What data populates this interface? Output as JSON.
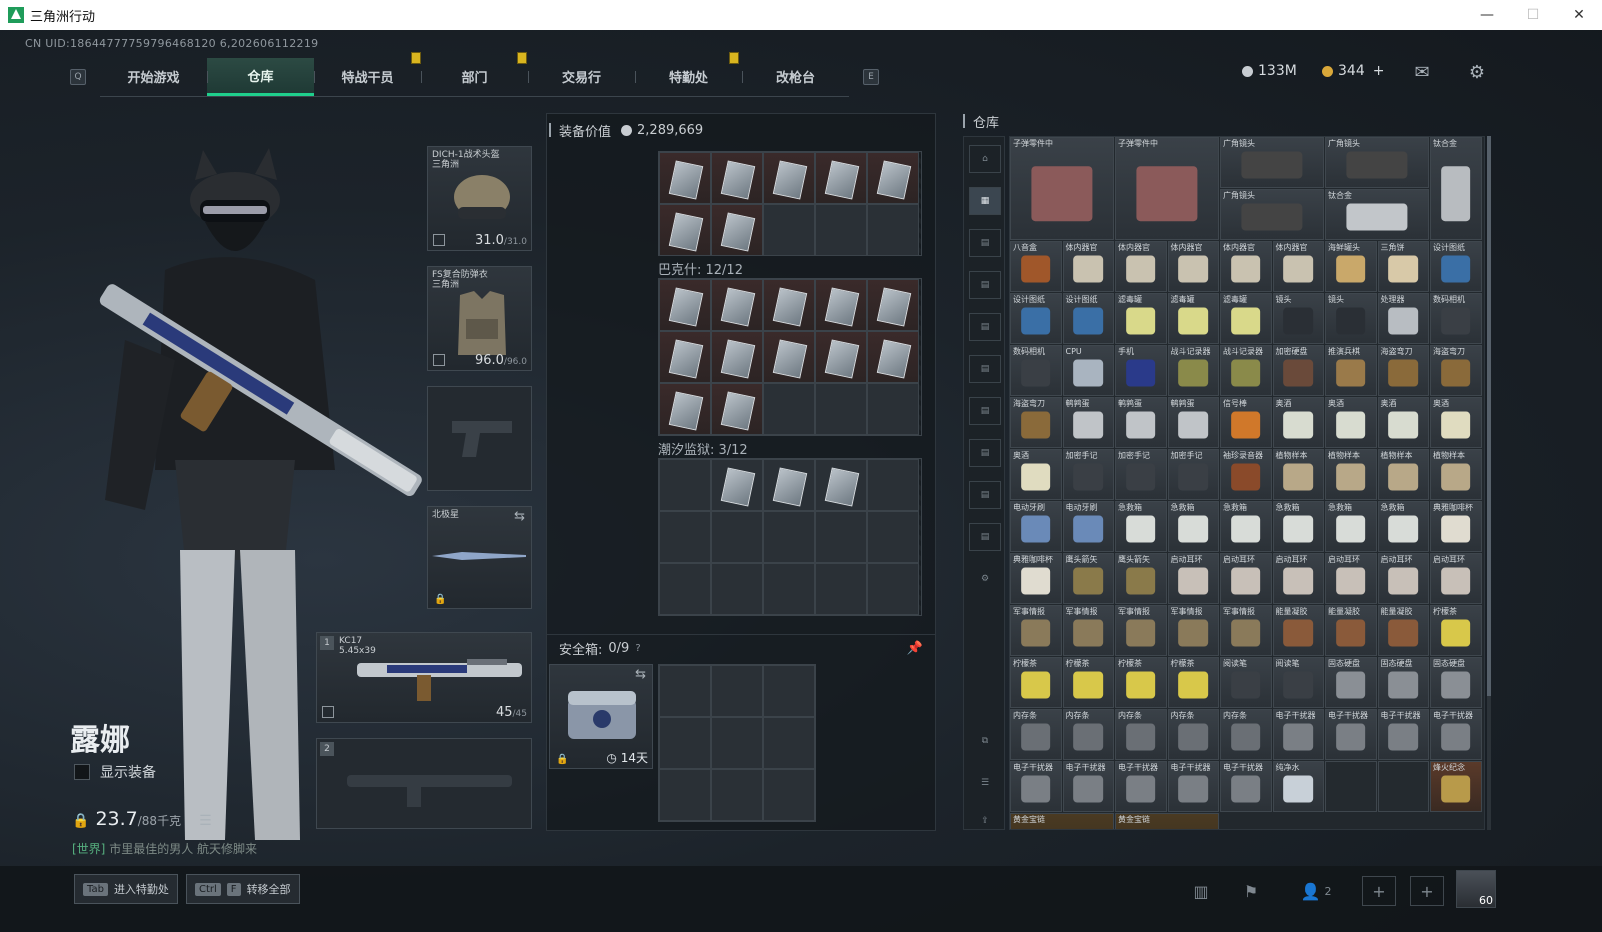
{
  "window": {
    "title": "三角洲行动",
    "min": "—",
    "max": "☐",
    "close": "✕"
  },
  "uid": "CN UID:18644777759796468120 6,202606112219",
  "nav": {
    "left_key": "Q",
    "right_key": "E",
    "tabs": [
      {
        "label": "开始游戏"
      },
      {
        "label": "仓库"
      },
      {
        "label": "特战干员"
      },
      {
        "label": "部门"
      },
      {
        "label": "交易行"
      },
      {
        "label": "特勤处"
      },
      {
        "label": "改枪台"
      }
    ]
  },
  "currency": {
    "silver": "133M",
    "gold": "344",
    "plus": "+"
  },
  "icons": {
    "mail": "mail-icon",
    "settings": "gear-icon"
  },
  "character": {
    "name": "露娜",
    "show_equipment": "显示装备",
    "weight": "23.7",
    "weight_max": "/88千克",
    "chat_channel": "[世界]",
    "chat_text": "市里最佳的男人 航天修脚来"
  },
  "equipment": {
    "helmet": {
      "name": "DICH-1战术头盔",
      "sub": "三角洲",
      "durability": "31.0",
      "max": "/31.0"
    },
    "armor": {
      "name": "FS复合防弹衣",
      "sub": "三角洲",
      "durability": "96.0",
      "max": "/96.0"
    },
    "melee": {
      "name": "北极星"
    },
    "primary": {
      "slot": "1",
      "name": "KC17",
      "ammo_label": "5.45x39",
      "ammo": "45",
      "ammo_max": "/45"
    },
    "secondary": {
      "slot": "2"
    }
  },
  "mid": {
    "value_label": "装备价值",
    "value": "2,289,669",
    "bags": [
      {
        "label": "巴克什: 12/12"
      },
      {
        "label": "潮汐监狱: 3/12"
      }
    ],
    "safe_label": "安全箱:",
    "safe_count": "0/9",
    "safe_help": "?",
    "safe_days": "14天"
  },
  "warehouse": {
    "title": "仓库",
    "items": [
      {
        "name": "子弹零件中",
        "color": "#8b5a5a"
      },
      {
        "name": "子弹零件中",
        "color": "#8b5a5a"
      },
      {
        "name": "广角镜头",
        "color": "#444"
      },
      {
        "name": "广角镜头",
        "color": "#444"
      },
      {
        "name": "钛合金",
        "color": "#b8bcc0"
      },
      {
        "name": "广角镜头",
        "color": "#444"
      },
      {
        "name": "钛合金",
        "color": "#c2c6ca"
      },
      {
        "name": "八音盒",
        "color": "#a0572a"
      },
      {
        "name": "体内器官",
        "color": "#c9c2b0"
      },
      {
        "name": "体内器官",
        "color": "#c9c2b0"
      },
      {
        "name": "体内器官",
        "color": "#c9c2b0"
      },
      {
        "name": "体内器官",
        "color": "#c9c2b0"
      },
      {
        "name": "体内器官",
        "color": "#c9c2b0"
      },
      {
        "name": "海鲜罐头",
        "color": "#c9a86a"
      },
      {
        "name": "三角饼",
        "color": "#d8c9a8"
      },
      {
        "name": "设计图纸",
        "color": "#3a6fa6"
      },
      {
        "name": "设计图纸",
        "color": "#3a6fa6"
      },
      {
        "name": "设计图纸",
        "color": "#3a6fa6"
      },
      {
        "name": "滤毒罐",
        "color": "#d9d98a"
      },
      {
        "name": "滤毒罐",
        "color": "#d9d98a"
      },
      {
        "name": "滤毒罐",
        "color": "#d9d98a"
      },
      {
        "name": "镜头",
        "color": "#2a2f35"
      },
      {
        "name": "镜头",
        "color": "#2a2f35"
      },
      {
        "name": "处理器",
        "color": "#b8bdc2"
      },
      {
        "name": "数码相机",
        "color": "#3a3f45"
      },
      {
        "name": "数码相机",
        "color": "#3a3f45"
      },
      {
        "name": "CPU",
        "color": "#a9b4c0"
      },
      {
        "name": "手机",
        "color": "#2a3a8a"
      },
      {
        "name": "战斗记录器",
        "color": "#8a8a4a"
      },
      {
        "name": "战斗记录器",
        "color": "#8a8a4a"
      },
      {
        "name": "加密硬盘",
        "color": "#6a4a3a"
      },
      {
        "name": "推演兵棋",
        "color": "#9a7a4a"
      },
      {
        "name": "海盗弯刀",
        "color": "#8a6a3a"
      },
      {
        "name": "海盗弯刀",
        "color": "#8a6a3a"
      },
      {
        "name": "海盗弯刀",
        "color": "#8a6a3a"
      },
      {
        "name": "鹌鹑蛋",
        "color": "#c0c4c8"
      },
      {
        "name": "鹌鹑蛋",
        "color": "#c0c4c8"
      },
      {
        "name": "鹌鹑蛋",
        "color": "#c0c4c8"
      },
      {
        "name": "信号棒",
        "color": "#d0782a"
      },
      {
        "name": "奥酒",
        "color": "#d8dcd0"
      },
      {
        "name": "奥酒",
        "color": "#d8dcd0"
      },
      {
        "name": "奥酒",
        "color": "#d8dcd0"
      },
      {
        "name": "奥酒",
        "color": "#e0dcc0"
      },
      {
        "name": "奥酒",
        "color": "#e0dcc0"
      },
      {
        "name": "加密手记",
        "color": "#3a3f45"
      },
      {
        "name": "加密手记",
        "color": "#3a3f45"
      },
      {
        "name": "加密手记",
        "color": "#3a3f45"
      },
      {
        "name": "袖珍录音器",
        "color": "#8a4a2a"
      },
      {
        "name": "植物样本",
        "color": "#b8a888"
      },
      {
        "name": "植物样本",
        "color": "#b8a888"
      },
      {
        "name": "植物样本",
        "color": "#b8a888"
      },
      {
        "name": "植物样本",
        "color": "#b8a888"
      },
      {
        "name": "电动牙刷",
        "color": "#6a8ab8"
      },
      {
        "name": "电动牙刷",
        "color": "#6a8ab8"
      },
      {
        "name": "急救箱",
        "color": "#d8dcd8"
      },
      {
        "name": "急救箱",
        "color": "#d8dcd8"
      },
      {
        "name": "急救箱",
        "color": "#d8dcd8"
      },
      {
        "name": "急救箱",
        "color": "#d8dcd8"
      },
      {
        "name": "急救箱",
        "color": "#d8dcd8"
      },
      {
        "name": "急救箱",
        "color": "#d8dcd8"
      },
      {
        "name": "典雅咖啡杯",
        "color": "#e0dcd0"
      },
      {
        "name": "典雅咖啡杯",
        "color": "#e0dcd0"
      },
      {
        "name": "鹰头箭矢",
        "color": "#8a7a4a"
      },
      {
        "name": "鹰头箭矢",
        "color": "#8a7a4a"
      },
      {
        "name": "启动耳环",
        "color": "#c8c0b8"
      },
      {
        "name": "启动耳环",
        "color": "#c8c0b8"
      },
      {
        "name": "启动耳环",
        "color": "#c8c0b8"
      },
      {
        "name": "启动耳环",
        "color": "#c8c0b8"
      },
      {
        "name": "启动耳环",
        "color": "#c8c0b8"
      },
      {
        "name": "启动耳环",
        "color": "#c8c0b8"
      },
      {
        "name": "军事情报",
        "color": "#8a7a5a"
      },
      {
        "name": "军事情报",
        "color": "#8a7a5a"
      },
      {
        "name": "军事情报",
        "color": "#8a7a5a"
      },
      {
        "name": "军事情报",
        "color": "#8a7a5a"
      },
      {
        "name": "军事情报",
        "color": "#8a7a5a"
      },
      {
        "name": "能量凝胶",
        "color": "#8a5a3a"
      },
      {
        "name": "能量凝胶",
        "color": "#8a5a3a"
      },
      {
        "name": "能量凝胶",
        "color": "#8a5a3a"
      },
      {
        "name": "柠檬茶",
        "color": "#d8c84a"
      },
      {
        "name": "柠檬茶",
        "color": "#d8c84a"
      },
      {
        "name": "柠檬茶",
        "color": "#d8c84a"
      },
      {
        "name": "柠檬茶",
        "color": "#d8c84a"
      },
      {
        "name": "柠檬茶",
        "color": "#d8c84a"
      },
      {
        "name": "阅读笔",
        "color": "#3a3f45"
      },
      {
        "name": "阅读笔",
        "color": "#3a3f45"
      },
      {
        "name": "固态硬盘",
        "color": "#8a8f95"
      },
      {
        "name": "固态硬盘",
        "color": "#8a8f95"
      },
      {
        "name": "固态硬盘",
        "color": "#8a8f95"
      },
      {
        "name": "内存条",
        "color": "#6a6f75"
      },
      {
        "name": "内存条",
        "color": "#6a6f75"
      },
      {
        "name": "内存条",
        "color": "#6a6f75"
      },
      {
        "name": "内存条",
        "color": "#6a6f75"
      },
      {
        "name": "内存条",
        "color": "#6a6f75"
      },
      {
        "name": "电子干扰器",
        "color": "#7a7f85"
      },
      {
        "name": "电子干扰器",
        "color": "#7a7f85"
      },
      {
        "name": "电子干扰器",
        "color": "#7a7f85"
      },
      {
        "name": "电子干扰器",
        "color": "#7a7f85"
      },
      {
        "name": "电子干扰器",
        "color": "#7a7f85"
      },
      {
        "name": "电子干扰器",
        "color": "#7a7f85"
      },
      {
        "name": "电子干扰器",
        "color": "#7a7f85"
      },
      {
        "name": "电子干扰器",
        "color": "#7a7f85"
      },
      {
        "name": "电子干扰器",
        "color": "#7a7f85"
      },
      {
        "name": "纯净水",
        "color": "#c8d0d8"
      },
      {
        "name": "",
        "color": ""
      },
      {
        "name": "",
        "color": ""
      },
      {
        "name": "烽火纪念",
        "color": "#b89a4a"
      }
    ],
    "bottom_labels": [
      "黄金宝链",
      "黄金宝链"
    ]
  },
  "bottom": {
    "tab_key": "Tab",
    "tab_label": "进入特勤处",
    "ctrl_key": "Ctrl",
    "f_key": "F",
    "transfer_label": "转移全部",
    "friends": "2",
    "level": "60"
  }
}
